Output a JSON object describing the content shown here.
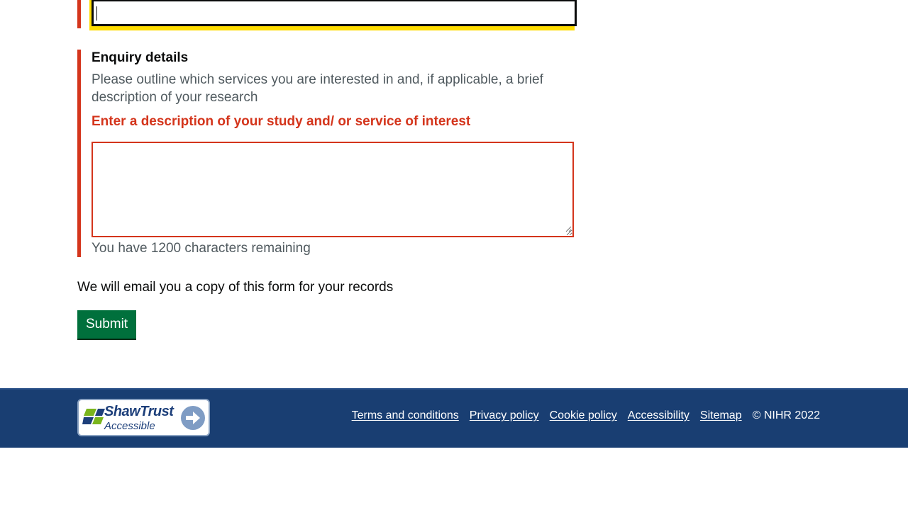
{
  "top_field": {
    "value": ""
  },
  "enquiry": {
    "label": "Enquiry details",
    "hint": "Please outline which services you are interested in and, if applicable, a brief description of your research",
    "error": "Enter a description of your study and/ or service of interest",
    "value": "",
    "counter": "You have 1200 characters remaining"
  },
  "email_note": "We will email you a copy of this form for your records",
  "submit_label": "Submit",
  "footer": {
    "badge": {
      "title": "ShawTrust",
      "subtitle": "Accessible"
    },
    "links": [
      "Terms and conditions",
      "Privacy policy",
      "Cookie policy",
      "Accessibility",
      "Sitemap"
    ],
    "copyright": "© NIHR 2022"
  },
  "colors": {
    "error": "#d4351c",
    "focus": "#ffdd00",
    "button": "#00703c",
    "footer": "#193e72",
    "hint_text": "#505a5f"
  },
  "icons": [
    "shawtrust-logo-icon",
    "arrow-right-icon",
    "resize-grip-icon"
  ]
}
